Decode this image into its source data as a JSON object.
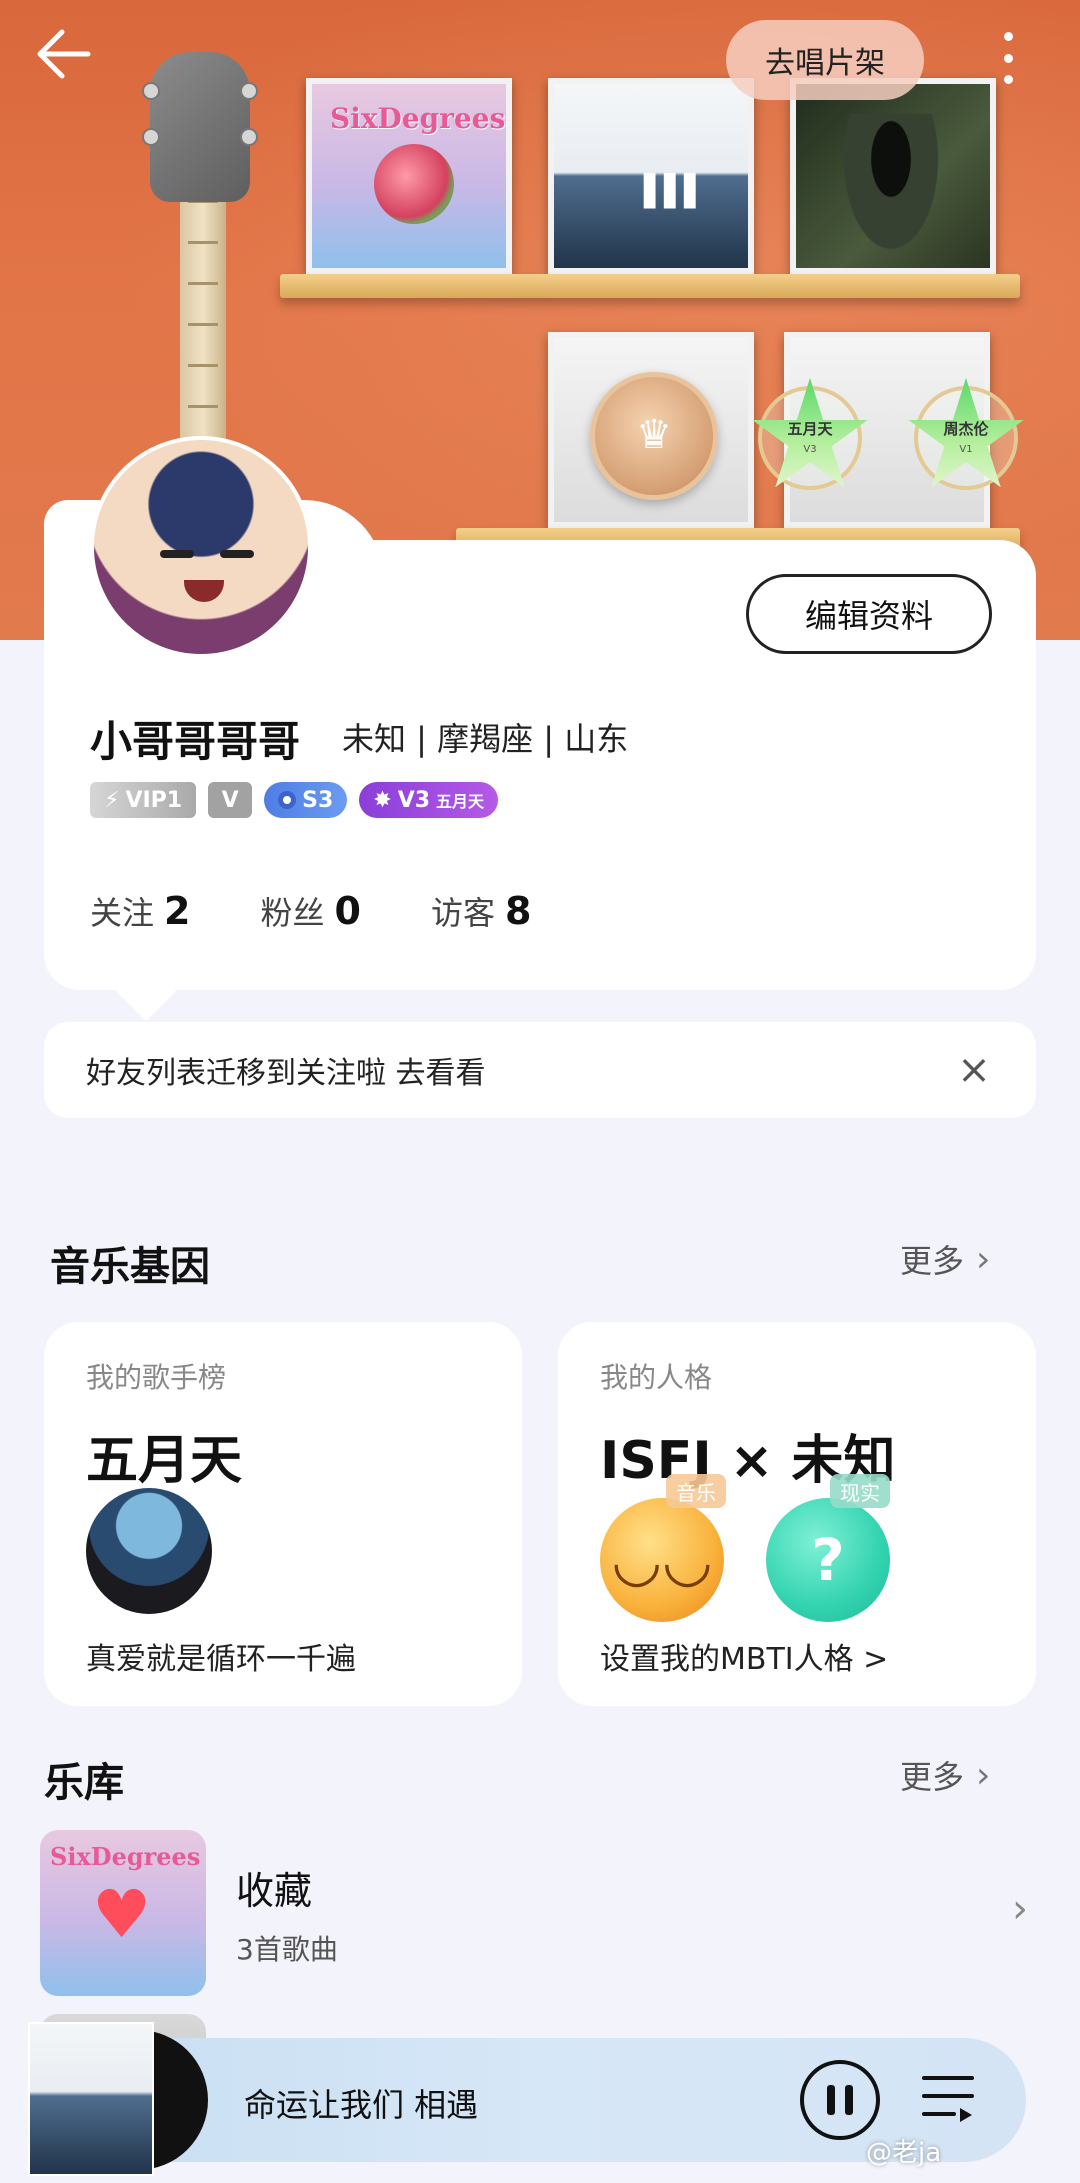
{
  "header": {
    "shelf_button": "去唱片架"
  },
  "shelf": {
    "albums": [
      {
        "title": "SixDegrees"
      },
      {
        "title": ""
      },
      {
        "title": ""
      }
    ],
    "badges": [
      {
        "name": "五月天",
        "level": "V3"
      },
      {
        "name": "周杰伦",
        "level": "V1"
      }
    ]
  },
  "profile": {
    "edit_button": "编辑资料",
    "username": "小哥哥哥哥",
    "meta": "未知 | 摩羯座 | 山东",
    "badges": {
      "vip": "VIP1",
      "s3": "S3",
      "v3": "V3",
      "v3_artist": "五月天"
    },
    "stats": {
      "following_label": "关注",
      "following": "2",
      "fans_label": "粉丝",
      "fans": "0",
      "visitors_label": "访客",
      "visitors": "8"
    }
  },
  "notice": {
    "text": "好友列表迁移到关注啦 去看看"
  },
  "music_dna": {
    "title": "音乐基因",
    "more": "更多",
    "singer_card": {
      "label": "我的歌手榜",
      "artist": "五月天",
      "song": "真爱就是循环一千遍"
    },
    "personality_card": {
      "label": "我的人格",
      "value": "ISFJ × 未知",
      "tag_music": "音乐",
      "tag_real": "现实",
      "action": "设置我的MBTI人格 >"
    }
  },
  "library": {
    "title": "乐库",
    "more": "更多",
    "items": [
      {
        "title": "收藏",
        "subtitle": "3首歌曲",
        "cover_text": "SixDegrees"
      }
    ]
  },
  "player": {
    "song": "命运让我们 相遇"
  },
  "watermark": "@老ja"
}
